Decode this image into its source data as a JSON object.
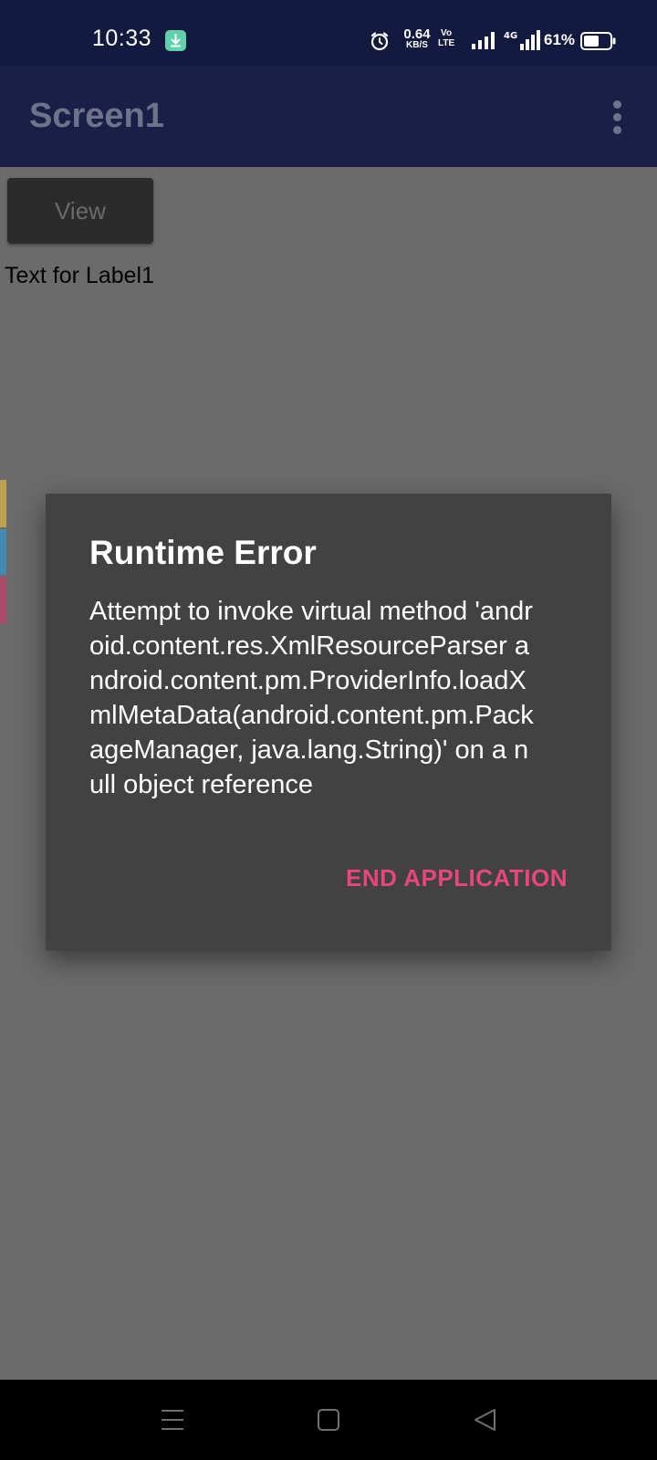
{
  "status_bar": {
    "time": "10:33",
    "net_speed_value": "0.64",
    "net_speed_unit": "KB/S",
    "volte_top": "Vo",
    "volte_bottom": "LTE",
    "battery_percent": "61%",
    "battery_level": 0.61,
    "icons": [
      "download-icon",
      "alarm-icon",
      "volte-icon",
      "signal-icon",
      "signal-4g-icon",
      "battery-icon"
    ]
  },
  "app_bar": {
    "title": "Screen1",
    "menu_icon": "overflow-menu-icon"
  },
  "content": {
    "view_button_label": "View",
    "label1_text": "Text for Label1"
  },
  "dialog": {
    "title": "Runtime Error",
    "message": "Attempt to invoke virtual method 'android.content.res.XmlResourceParser android.content.pm.ProviderInfo.loadXmlMetaData(android.content.pm.PackageManager, java.lang.String)' on a null object reference",
    "button_label": "END APPLICATION"
  },
  "nav_bar": {
    "icons": [
      "menu-icon",
      "home-icon",
      "back-icon"
    ]
  },
  "colors": {
    "status_bar_bg": "#131a3f",
    "app_bar_bg": "#1a1f47",
    "dimmed_bg": "#6b6b6b",
    "dialog_bg": "#424242",
    "accent": "#e9467f",
    "edge_strip_yellow": "#c9a550",
    "edge_strip_blue": "#3f8fb8",
    "edge_strip_pink": "#b04a6a"
  }
}
